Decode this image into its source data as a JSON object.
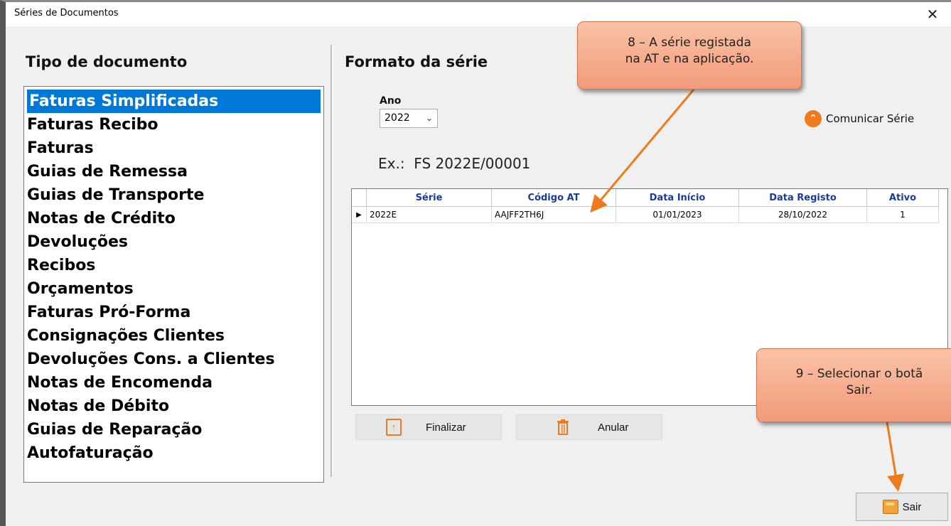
{
  "window": {
    "title": "Séries de Documentos",
    "close_glyph": "✕"
  },
  "left_panel": {
    "heading": "Tipo de documento",
    "items": [
      "Faturas Simplificadas",
      "Faturas Recibo",
      "Faturas",
      "Guias de Remessa",
      "Guias de Transporte",
      "Notas de Crédito",
      "Devoluções",
      "Recibos",
      "Orçamentos",
      "Faturas Pró-Forma",
      "Consignações Clientes",
      "Devoluções Cons. a Clientes",
      "Notas de Encomenda",
      "Notas de Débito",
      "Guias de Reparação",
      "Autofaturação"
    ],
    "selected_index": 0
  },
  "right_panel": {
    "heading": "Formato da série",
    "ano_label": "Ano",
    "ano_value": "2022",
    "example_label": "Ex.:",
    "example_value": "FS 2022E/00001",
    "comunicar_label": "Comunicar Série",
    "comunicar_icon": "chevron-up-circle-icon"
  },
  "grid": {
    "columns": [
      "Série",
      "Código AT",
      "Data Início",
      "Data Registo",
      "Ativo"
    ],
    "rows": [
      {
        "serie": "2022E",
        "codigo_at": "AAJFF2TH6J",
        "data_inicio": "01/01/2023",
        "data_registo": "28/10/2022",
        "ativo": "1"
      }
    ],
    "current_row_marker": "▶"
  },
  "buttons": {
    "finalizar": "Finalizar",
    "anular": "Anular",
    "sair": "Sair"
  },
  "callouts": {
    "c8_line1": "8 – A série registada",
    "c8_line2": "na AT e na aplicação.",
    "c9_line1": "9 – Selecionar o botã",
    "c9_line2": "Sair."
  },
  "colors": {
    "selection": "#0078d7",
    "header_text": "#1c3a9e",
    "accent": "#f07b1d",
    "callout": "#f29a79"
  }
}
